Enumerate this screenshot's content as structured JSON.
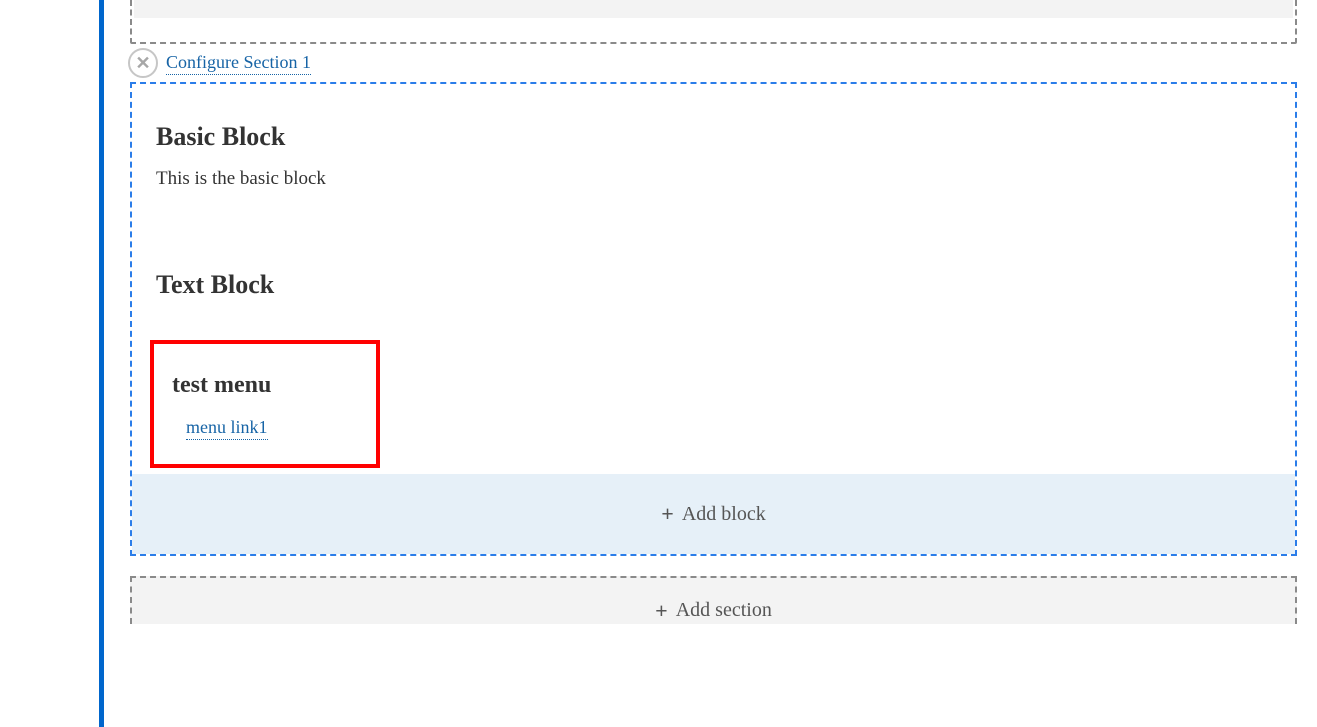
{
  "section": {
    "configure_label": "Configure Section 1",
    "blocks": {
      "basic": {
        "title": "Basic Block",
        "body": "This is the basic block"
      },
      "text": {
        "title": "Text Block"
      },
      "menu": {
        "title": "test menu",
        "link_label": "menu link1"
      }
    },
    "add_block_label": "Add block"
  },
  "add_section_label": "Add section"
}
